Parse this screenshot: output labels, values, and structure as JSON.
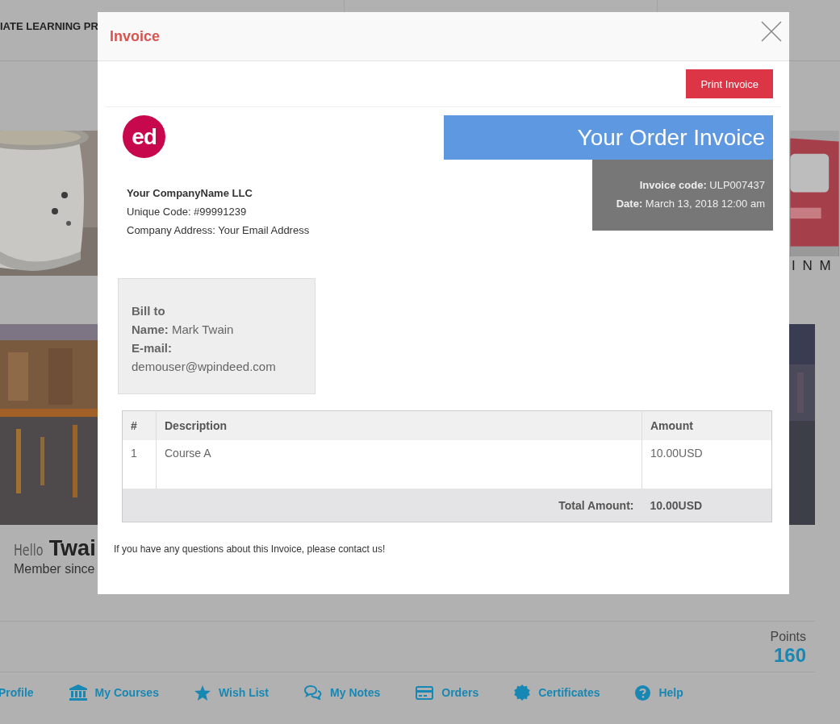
{
  "background_page": {
    "header_text": "IATE LEARNING PR",
    "banner_text": "I N M",
    "profile": {
      "greeting": "Hello",
      "name": "Twai",
      "member_since": "Member since"
    },
    "points": {
      "label": "Points",
      "value": "160"
    },
    "nav": [
      {
        "label": "Profile",
        "kind": "text"
      },
      {
        "label": "My Courses",
        "kind": "courses"
      },
      {
        "label": "Wish List",
        "kind": "wishlist"
      },
      {
        "label": "My Notes",
        "kind": "notes"
      },
      {
        "label": "Orders",
        "kind": "orders"
      },
      {
        "label": "Certificates",
        "kind": "certificates"
      },
      {
        "label": "Help",
        "kind": "help"
      }
    ]
  },
  "modal": {
    "title": "Invoice",
    "print_button": "Print Invoice",
    "logo": "ed",
    "company": {
      "name": "Your CompanyName LLC",
      "unique_code": "Unique Code: #99991239",
      "address": "Company Address: Your Email Address"
    },
    "invoice_header": {
      "title": "Your Order Invoice",
      "code_label": "Invoice code:",
      "code_value": "ULP007437",
      "date_label": "Date:",
      "date_value": "March 13, 2018 12:00 am"
    },
    "bill_to": {
      "heading": "Bill to",
      "name_label": "Name:",
      "name_value": "Mark Twain",
      "email_label": "E-mail:",
      "email_value": "demouser@wpindeed.com"
    },
    "table": {
      "columns": [
        "#",
        "Description",
        "Amount"
      ],
      "rows": [
        [
          "1",
          "Course A",
          "10.00USD"
        ]
      ],
      "total_label": "Total Amount:",
      "total_value": "10.00USD"
    },
    "footer_note": "If you have any questions about this Invoice, please contact us!"
  }
}
